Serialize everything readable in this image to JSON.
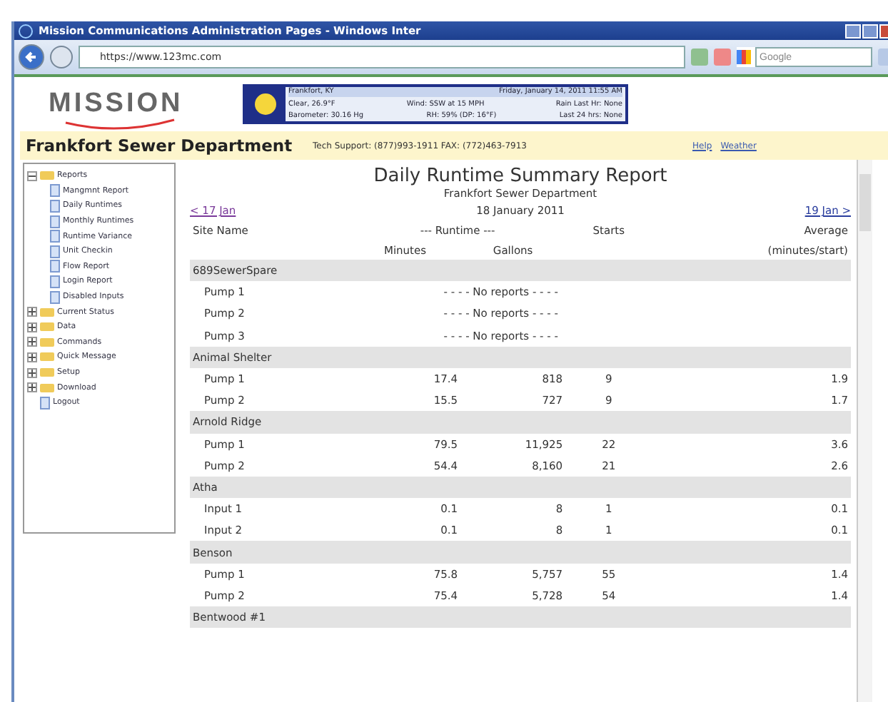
{
  "window": {
    "title": "Mission Communications Administration Pages - Windows Inter"
  },
  "address_bar": {
    "url": "https://www.123mc.com"
  },
  "search": {
    "placeholder": "Google"
  },
  "weather": {
    "location": "Frankfort, KY",
    "datetime": "Friday, January 14, 2011 11:55 AM",
    "condition": "Clear, 26.9°F",
    "barometer": "Barometer: 30.16 Hg",
    "wind": "Wind: SSW at 15 MPH",
    "humidity": "RH: 59% (DP: 16°F)",
    "rain_hour": "Rain Last Hr: None",
    "rain_day": "Last 24 hrs: None"
  },
  "header": {
    "logo": "MISSION",
    "department": "Frankfort Sewer Department",
    "support": "Tech Support: (877)993-1911 FAX: (772)463-7913",
    "links": [
      "Help",
      "Weather"
    ]
  },
  "sidebar": {
    "items": [
      {
        "label": "Reports",
        "kind": "folder",
        "expanded": true,
        "children": [
          {
            "label": "Mangmnt Report",
            "kind": "page"
          },
          {
            "label": "Daily Runtimes",
            "kind": "page"
          },
          {
            "label": "Monthly Runtimes",
            "kind": "page"
          },
          {
            "label": "Runtime Variance",
            "kind": "page"
          },
          {
            "label": "Unit Checkin",
            "kind": "page"
          },
          {
            "label": "Flow Report",
            "kind": "page"
          },
          {
            "label": "Login Report",
            "kind": "page"
          },
          {
            "label": "Disabled Inputs",
            "kind": "page"
          }
        ]
      },
      {
        "label": "Current Status",
        "kind": "folder",
        "expanded": false
      },
      {
        "label": "Data",
        "kind": "folder",
        "expanded": false
      },
      {
        "label": "Commands",
        "kind": "folder",
        "expanded": false
      },
      {
        "label": "Quick Message",
        "kind": "folder",
        "expanded": false
      },
      {
        "label": "Setup",
        "kind": "folder",
        "expanded": false
      },
      {
        "label": "Download",
        "kind": "folder",
        "expanded": false
      },
      {
        "label": "Logout",
        "kind": "page"
      }
    ]
  },
  "report": {
    "title": "Daily Runtime Summary Report",
    "subtitle": "Frankfort Sewer Department",
    "date": "18 January 2011",
    "prev": "< 17 Jan",
    "next": "19 Jan >",
    "columns": [
      "Site Name",
      "--- Runtime ---",
      "Starts",
      "Average"
    ],
    "subcolumns": [
      "Minutes",
      "Gallons",
      "(minutes/start)"
    ],
    "groups": [
      {
        "site": "689SewerSpare",
        "rows": [
          {
            "kind": "empty",
            "name": "Pump 1",
            "note": "- - - - No reports - - - -"
          },
          {
            "kind": "empty",
            "name": "Pump 2",
            "note": "- - - - No reports - - - -"
          },
          {
            "kind": "empty",
            "name": "Pump 3",
            "note": "- - - - No reports - - - -"
          }
        ]
      },
      {
        "site": "Animal Shelter",
        "rows": [
          {
            "kind": "data",
            "name": "Pump 1",
            "minutes": "17.4",
            "gallons": "818",
            "starts": "9",
            "average": "1.9"
          },
          {
            "kind": "data",
            "name": "Pump 2",
            "minutes": "15.5",
            "gallons": "727",
            "starts": "9",
            "average": "1.7"
          }
        ]
      },
      {
        "site": "Arnold Ridge",
        "rows": [
          {
            "kind": "data",
            "name": "Pump 1",
            "minutes": "79.5",
            "gallons": "11,925",
            "starts": "22",
            "average": "3.6"
          },
          {
            "kind": "data",
            "name": "Pump 2",
            "minutes": "54.4",
            "gallons": "8,160",
            "starts": "21",
            "average": "2.6"
          }
        ]
      },
      {
        "site": "Atha",
        "rows": [
          {
            "kind": "data",
            "name": "Input 1",
            "minutes": "0.1",
            "gallons": "8",
            "starts": "1",
            "average": "0.1"
          },
          {
            "kind": "data",
            "name": "Input 2",
            "minutes": "0.1",
            "gallons": "8",
            "starts": "1",
            "average": "0.1"
          }
        ]
      },
      {
        "site": "Benson",
        "rows": [
          {
            "kind": "data",
            "name": "Pump 1",
            "minutes": "75.8",
            "gallons": "5,757",
            "starts": "55",
            "average": "1.4"
          },
          {
            "kind": "data",
            "name": "Pump 2",
            "minutes": "75.4",
            "gallons": "5,728",
            "starts": "54",
            "average": "1.4"
          }
        ]
      },
      {
        "site": "Bentwood #1"
      }
    ]
  }
}
